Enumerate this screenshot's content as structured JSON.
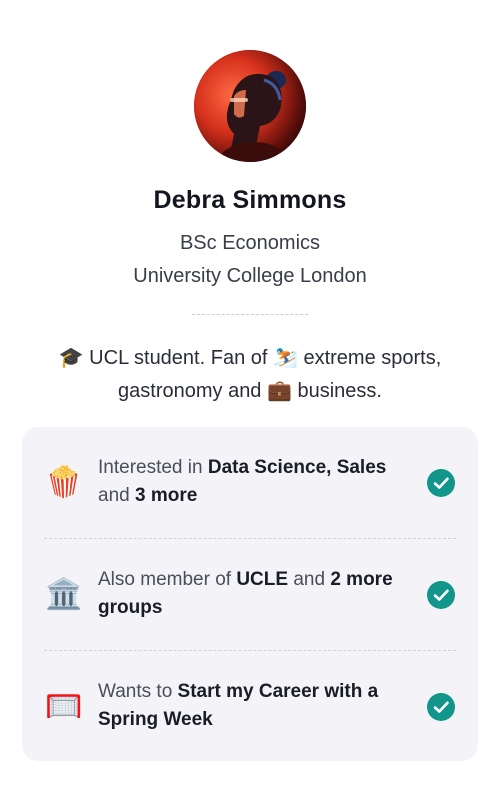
{
  "profile": {
    "name": "Debra Simmons",
    "degree": "BSc Economics",
    "university": "University College London",
    "bio": {
      "part1_icon": "🎓",
      "part1": " UCL student. Fan of ",
      "part2_icon": "⛷️",
      "part2": " extreme sports, gastronomy and ",
      "part3_icon": "💼",
      "part3": " business."
    }
  },
  "card": {
    "rows": [
      {
        "icon": "🍿",
        "icon_name": "popcorn-icon",
        "prefix": "Interested in ",
        "bold1": "Data Science, Sales",
        "middle": " and ",
        "bold2": "3 more",
        "checked": true
      },
      {
        "icon": "🏛️",
        "icon_name": "classical-building-icon",
        "prefix": "Also member of ",
        "bold1": "UCLE",
        "middle": " and ",
        "bold2": "2 more groups",
        "checked": true
      },
      {
        "icon": "🥅",
        "icon_name": "goal-net-icon",
        "prefix": "Wants to ",
        "bold1": "Start my Career with a Spring Week",
        "middle": "",
        "bold2": "",
        "checked": true
      }
    ]
  },
  "colors": {
    "accent_check": "#12958a",
    "card_bg": "#f4f4f8"
  }
}
